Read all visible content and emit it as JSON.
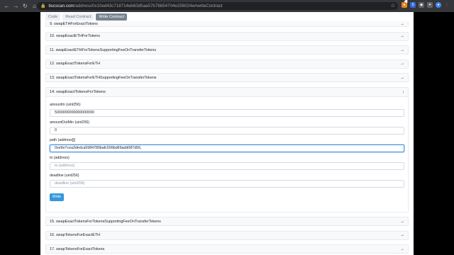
{
  "browser": {
    "url_host": "bscscan.com",
    "url_rest": "/address/0x10ed43c718714eb63d5aa57b78b54704e256024e#writeContract"
  },
  "tabs": [
    "Code",
    "Read Contract",
    "Write Contract"
  ],
  "items_before": [
    "9. swapETHForExactTokens",
    "10. swapExactETHForTokens",
    "11. swapExactETHForTokensSupportingFeeOnTransferTokens",
    "12. swapExactTokensForETH",
    "13. swapExactTokensForETHSupportingFeeOnTransferTokens"
  ],
  "open_item": {
    "title": "14. swapExactTokensForTokens",
    "fields": [
      {
        "label": "amountIn (uint256)",
        "value": "5000000000000000000",
        "placeholder": ""
      },
      {
        "label": "amountOutMin (uint256)",
        "value": "0",
        "placeholder": ""
      },
      {
        "label": "path (address[])",
        "value": "0xe9e7cea3dedca5984780bafc599bd69add087d56,",
        "placeholder": ""
      },
      {
        "label": "to (address)",
        "value": "",
        "placeholder": "to (address)"
      },
      {
        "label": "deadline (uint256)",
        "value": "",
        "placeholder": "deadline (uint256)"
      }
    ],
    "write_label": "Write"
  },
  "items_after": [
    "15. swapExactTokensForTokensSupportingFeeOnTransferTokens",
    "16. swapTokensForExactETH",
    "17. swapTokensForExactTokens"
  ],
  "icons": {
    "collapsed_arrow": "→",
    "expanded_arrow": "↓"
  },
  "colors": {
    "write_button": "#3498db",
    "active_tab": "#77838f",
    "focus_border": "#4a90e2"
  }
}
